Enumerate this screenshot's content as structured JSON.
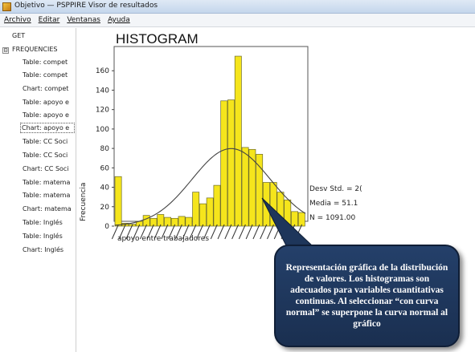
{
  "window": {
    "title": "Objetivo — PSPPIRE Visor de resultados"
  },
  "menu": [
    {
      "label": "Archivo"
    },
    {
      "label": "Editar"
    },
    {
      "label": "Ventanas"
    },
    {
      "label": "Ayuda"
    }
  ],
  "sidebar": {
    "items": [
      {
        "label": "GET",
        "indent": 0
      },
      {
        "label": "FREQUENCIES",
        "indent": 0
      },
      {
        "label": "Table: compet",
        "indent": 1
      },
      {
        "label": "Table: compet",
        "indent": 1
      },
      {
        "label": "Chart: compet",
        "indent": 1
      },
      {
        "label": "Table: apoyo e",
        "indent": 1
      },
      {
        "label": "Table: apoyo e",
        "indent": 1
      },
      {
        "label": "Chart: apoyo e",
        "indent": 1
      },
      {
        "label": "Table: CC Soci",
        "indent": 1
      },
      {
        "label": "Table: CC Soci",
        "indent": 1
      },
      {
        "label": "Chart: CC Soci",
        "indent": 1
      },
      {
        "label": "Table: matema",
        "indent": 1
      },
      {
        "label": "Table: matema",
        "indent": 1
      },
      {
        "label": "Chart: matema",
        "indent": 1
      },
      {
        "label": "Table: Inglés",
        "indent": 1
      },
      {
        "label": "Table: Inglés",
        "indent": 1
      },
      {
        "label": "Chart: Inglés",
        "indent": 1
      }
    ],
    "expander_symbol": "⊟",
    "selected_index": 7
  },
  "chart_data": {
    "type": "bar",
    "title": "HISTOGRAM",
    "xlabel": "apoyo entre trabajadores",
    "ylabel": "Frecuencia",
    "ylim": [
      0,
      180
    ],
    "yticks": [
      0,
      20,
      40,
      60,
      80,
      100,
      120,
      140,
      160
    ],
    "values": [
      51,
      3,
      2,
      5,
      11,
      8,
      12,
      9,
      8,
      10,
      9,
      35,
      23,
      29,
      42,
      129,
      130,
      175,
      81,
      79,
      74,
      45,
      45,
      35,
      27,
      15,
      14
    ],
    "grid": false,
    "overlay": "normal curve",
    "stats": {
      "std": "Desv Std. = 2(",
      "mean": "Media = 51.1",
      "n": "N = 1091.00"
    },
    "colors": {
      "bar": "#f5e51c",
      "bar_edge": "#6b6a2a",
      "curve": "#444444"
    }
  },
  "callout": {
    "text": "Representación gráfica de la distribución de valores. Los histogramas son adecuados para variables cuantitativas continuas. Al seleccionar “con curva normal” se superpone la curva normal al gráfico",
    "color": "#1f3a60"
  }
}
